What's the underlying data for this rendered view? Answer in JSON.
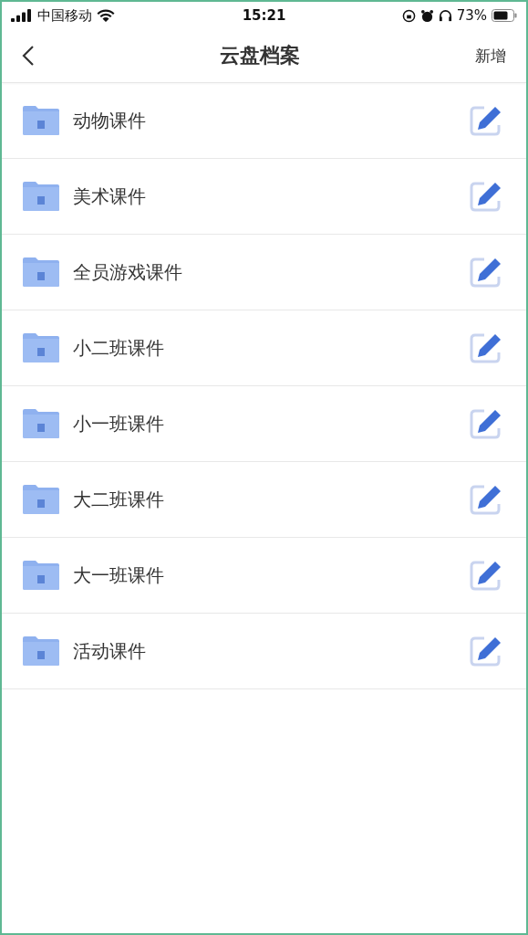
{
  "status_bar": {
    "carrier": "中国移动",
    "time": "15:21",
    "battery": "73%"
  },
  "nav": {
    "title": "云盘档案",
    "action": "新增"
  },
  "folders": [
    {
      "name": "动物课件"
    },
    {
      "name": "美术课件"
    },
    {
      "name": "全员游戏课件"
    },
    {
      "name": "小二班课件"
    },
    {
      "name": "小一班课件"
    },
    {
      "name": "大二班课件"
    },
    {
      "name": "大一班课件"
    },
    {
      "name": "活动课件"
    }
  ]
}
